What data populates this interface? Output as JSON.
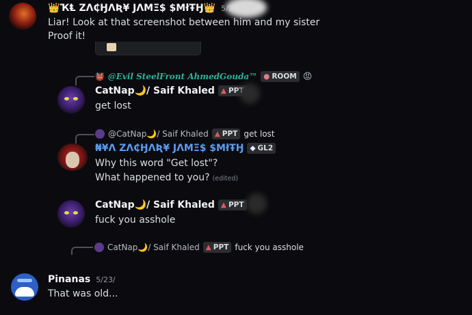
{
  "messages": [
    {
      "author": "👑ҠⱠ ZΛ₵ӇΛƦ¥ JΛMΞ$ $MłŦӇ👑",
      "timestamp": "5/23/2",
      "lines": [
        "Liar! Look at that screenshot between him and my sister",
        "Proof it!"
      ]
    },
    {
      "reply": {
        "author": "@Evil SteelFront AhmedGouda™",
        "badge": "ROOM",
        "emoji": "😡"
      },
      "author": "CatNap🌙/ Saif Khaled",
      "badge": "PPT",
      "lines": [
        "get lost"
      ]
    },
    {
      "reply": {
        "author": "@CatNap🌙/ Saif Khaled",
        "badge": "PPT",
        "text": "get lost"
      },
      "author": "₦¥Λ ZΛ₵ӇΛƦ¥ JΛMΞ$ $MłŦӇ",
      "badge": "GL2",
      "lines": [
        "Why this word \"Get lost\"?",
        "What happened to you?"
      ],
      "edited": "(edited)"
    },
    {
      "author": "CatNap🌙/ Saif Khaled",
      "badge": "PPT",
      "lines": [
        "fuck you asshole"
      ]
    },
    {
      "reply": {
        "author": "CatNap🌙/ Saif Khaled",
        "badge": "PPT",
        "text": "fuck you asshole"
      }
    },
    {
      "author": "Pinanas",
      "timestamp": "5/23/",
      "lines": [
        "That was old..."
      ]
    }
  ],
  "colors": {
    "background": "#0b0b0f",
    "accent_blue": "#5b9cf2",
    "reply_italic_teal": "#2fb39a",
    "badge_red": "#e05a5a"
  }
}
